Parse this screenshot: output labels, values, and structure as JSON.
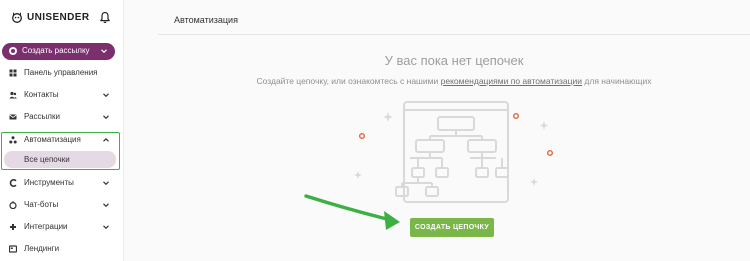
{
  "brand": {
    "logo_text": "UNISENDER"
  },
  "sidebar": {
    "create_button": {
      "label": "Создать рассылку",
      "icon": "plus-circle-icon"
    },
    "items": [
      {
        "label": "Панель управления",
        "icon": "dashboard-icon",
        "has_chevron": false
      },
      {
        "label": "Контакты",
        "icon": "contacts-icon",
        "has_chevron": true
      },
      {
        "label": "Рассылки",
        "icon": "mailing-icon",
        "has_chevron": true
      },
      {
        "label": "Автоматизация",
        "icon": "automation-icon",
        "has_chevron": true,
        "expanded": true
      },
      {
        "label": "Инструменты",
        "icon": "tools-icon",
        "has_chevron": true
      },
      {
        "label": "Чат-боты",
        "icon": "chatbot-icon",
        "has_chevron": true
      },
      {
        "label": "Интеграции",
        "icon": "integrations-icon",
        "has_chevron": true
      },
      {
        "label": "Лендинги",
        "icon": "landing-icon",
        "has_chevron": false
      }
    ],
    "sub_items": [
      {
        "label": "Все цепочки",
        "selected": true
      }
    ]
  },
  "main": {
    "page_title": "Автоматизация",
    "empty_title": "У вас пока нет цепочек",
    "empty_desc_before": "Создайте цепочку, или ознакомтесь с нашими",
    "empty_desc_link": "рекомендациями по автоматизации",
    "empty_desc_after": "для начинающих",
    "cta_label": "СОЗДАТЬ ЦЕПОЧКУ"
  },
  "colors": {
    "brand_purple": "#7b2f6f",
    "selected_bg": "#e4d9e4",
    "cta_green": "#7ab648",
    "annotation_green": "#3cb043",
    "sparkle_orange": "#e0653a"
  }
}
